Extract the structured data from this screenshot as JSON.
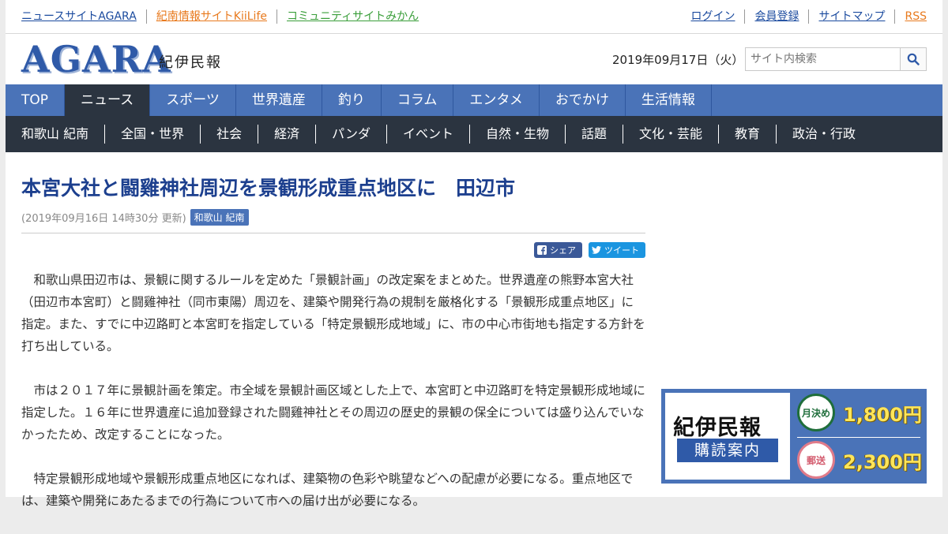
{
  "topbar": {
    "left_links": [
      "ニュースサイトAGARA",
      "紀南情報サイトKiiLife",
      "コミュニティサイトみかん"
    ],
    "left_colors": [
      "#1a4a9e",
      "#e87a1e",
      "#3a9e3a"
    ],
    "right_links": [
      "ログイン",
      "会員登録",
      "サイトマップ",
      "RSS"
    ]
  },
  "header": {
    "logo": "AGARA",
    "logo_sub": "紀伊民報",
    "date": "2019年09月17日（火）",
    "search_placeholder": "サイト内検索",
    "search_icon": "search-icon"
  },
  "main_nav": {
    "items": [
      "TOP",
      "ニュース",
      "スポーツ",
      "世界遺産",
      "釣り",
      "コラム",
      "エンタメ",
      "おでかけ",
      "生活情報"
    ],
    "active_index": 1
  },
  "sub_nav": {
    "items": [
      "和歌山 紀南",
      "全国・世界",
      "社会",
      "経済",
      "パンダ",
      "イベント",
      "自然・生物",
      "話題",
      "文化・芸能",
      "教育",
      "政治・行政"
    ]
  },
  "article": {
    "title": "本宮大社と闘雞神社周辺を景観形成重点地区に　田辺市",
    "meta": "(2019年09月16日 14時30分 更新)",
    "tag": "和歌山 紀南",
    "share_fb": "シェア",
    "share_tw": "ツイート",
    "paragraphs": [
      "和歌山県田辺市は、景観に関するルールを定めた「景観計画」の改定案をまとめた。世界遺産の熊野本宮大社（田辺市本宮町）と闘雞神社（同市東陽）周辺を、建築や開発行為の規制を厳格化する「景観形成重点地区」に指定。また、すでに中辺路町と本宮町を指定している「特定景観形成地域」に、市の中心市街地も指定する方針を打ち出している。",
      "市は２０１７年に景観計画を策定。市全域を景観計画区域とした上で、本宮町と中辺路町を特定景観形成地域に指定した。１６年に世界遺産に追加登録された闘雞神社とその周辺の歴史的景観の保全については盛り込んでいなかったため、改定することになった。",
      "特定景観形成地域や景観形成重点地区になれば、建築物の色彩や眺望などへの配慮が必要になる。重点地区では、建築や開発にあたるまでの行為について市への届け出が必要になる。"
    ]
  },
  "ad": {
    "paper_title": "紀伊民報",
    "paper_sub": "購読案内",
    "badge1": "月決め",
    "price1": "1,800円",
    "badge2": "郵送",
    "price2": "2,300円"
  }
}
